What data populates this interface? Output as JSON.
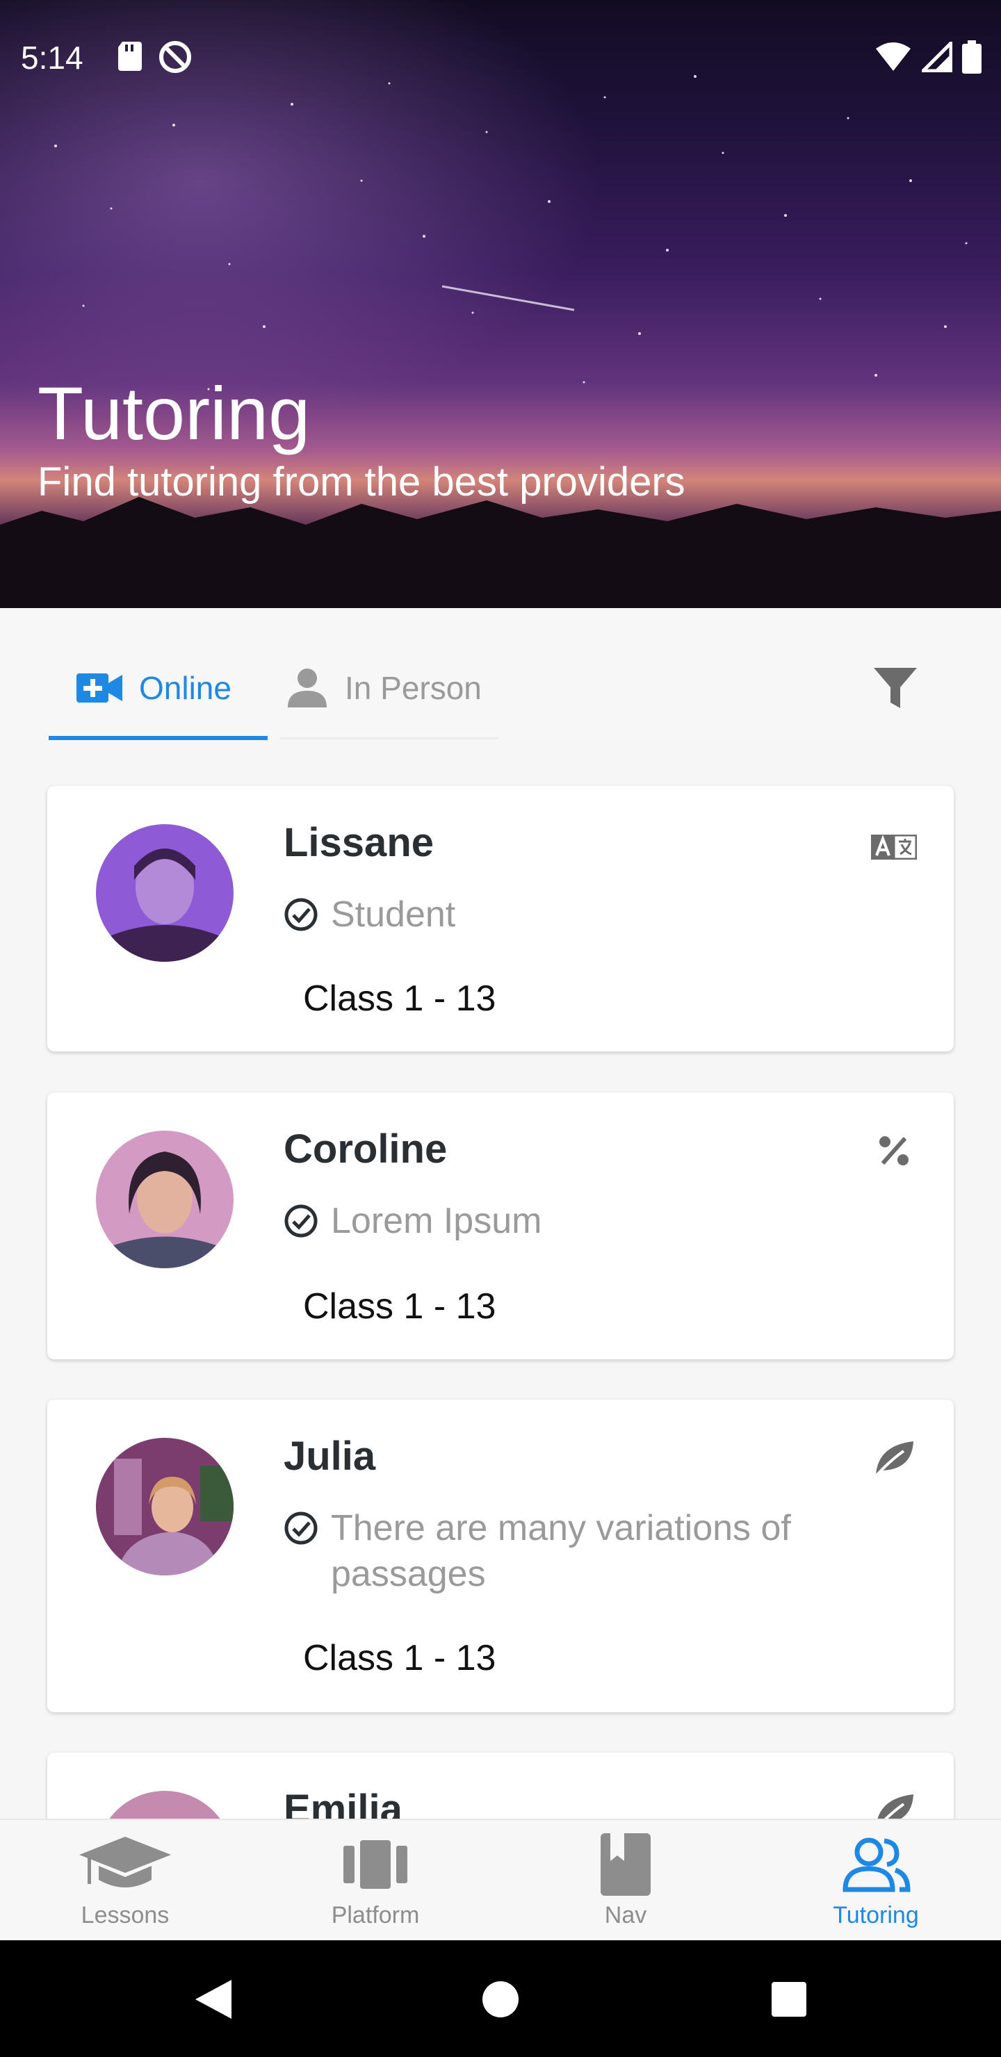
{
  "status_bar": {
    "time": "5:14"
  },
  "hero": {
    "title": "Tutoring",
    "subtitle": "Find tutoring from the best providers"
  },
  "tabs": [
    {
      "label": "Online",
      "icon": "video-plus-icon",
      "active": true
    },
    {
      "label": "In Person",
      "icon": "person-icon",
      "active": false
    }
  ],
  "filter_icon": "filter-icon",
  "tutors": [
    {
      "name": "Lissane",
      "role": "Student",
      "class": "Class 1 - 13",
      "corner_icon": "translate-icon"
    },
    {
      "name": "Coroline",
      "role": "Lorem Ipsum",
      "class": "Class 1 - 13",
      "corner_icon": "percent-icon"
    },
    {
      "name": "Julia",
      "role": "There are many variations of passages",
      "class": "Class 1 - 13",
      "corner_icon": "leaf-icon"
    },
    {
      "name": "Emilia",
      "corner_icon": "leaf-icon"
    }
  ],
  "bottom_nav": [
    {
      "label": "Lessons",
      "icon": "graduation-cap-icon",
      "active": false
    },
    {
      "label": "Platform",
      "icon": "carousel-icon",
      "active": false
    },
    {
      "label": "Nav",
      "icon": "book-icon",
      "active": false
    },
    {
      "label": "Tutoring",
      "icon": "people-icon",
      "active": true
    }
  ],
  "colors": {
    "accent": "#1e88e5",
    "text_dark": "#2a2f33",
    "muted": "#9a9a9a"
  }
}
